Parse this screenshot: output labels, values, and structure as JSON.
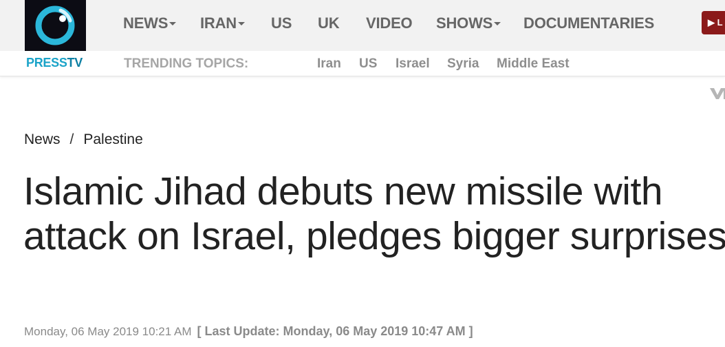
{
  "header": {
    "logo": {
      "brand_press": "PRESS",
      "brand_tv": "TV",
      "icon": "presstv-logo-icon"
    },
    "nav": [
      {
        "label": "NEWS",
        "dropdown": true
      },
      {
        "label": "IRAN",
        "dropdown": true
      },
      {
        "label": "US",
        "dropdown": false
      },
      {
        "label": "UK",
        "dropdown": false
      },
      {
        "label": "VIDEO",
        "dropdown": false
      },
      {
        "label": "SHOWS",
        "dropdown": true
      },
      {
        "label": "DOCUMENTARIES",
        "dropdown": false
      }
    ],
    "live_button": {
      "label": "▶ L",
      "icon": "play-icon",
      "color": "#8b1a1a"
    }
  },
  "trending": {
    "label": "TRENDING TOPICS:",
    "items": [
      "Iran",
      "US",
      "Israel",
      "Syria",
      "Middle East"
    ]
  },
  "breadcrumb": {
    "items": [
      "News",
      "Palestine"
    ],
    "separator": "/"
  },
  "article": {
    "headline": "Islamic Jihad debuts new missile with attack on Israel, pledges bigger surprises",
    "published": "Monday, 06 May 2019 10:21 AM",
    "last_update": "[ Last Update: Monday, 06 May 2019 10:47 AM ]"
  },
  "colors": {
    "topbar_bg": "#f2f2f2",
    "nav_text": "#666666",
    "brand_cyan": "#1aa3c8",
    "headline_text": "#222222",
    "meta_text": "#8a8a8a"
  }
}
